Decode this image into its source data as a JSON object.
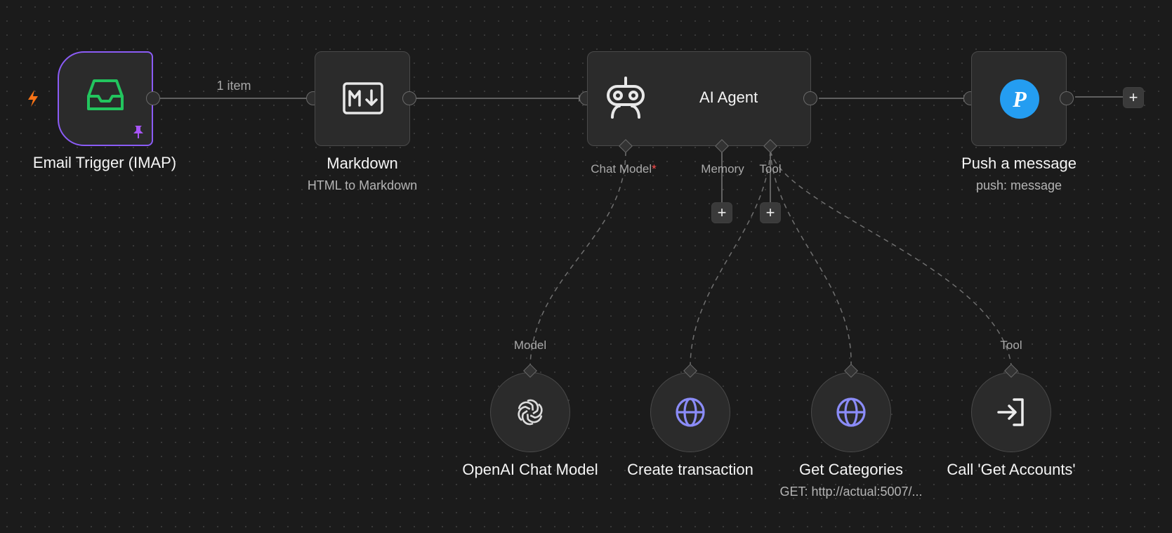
{
  "canvas": {
    "edge_label_1_item": "1 item"
  },
  "nodes": {
    "email_trigger": {
      "title": "Email Trigger (IMAP)",
      "icon": "inbox-icon",
      "icon_color": "#22c55e",
      "border_color": "#8b5cf6",
      "pinned": true
    },
    "markdown": {
      "title": "Markdown",
      "subtitle": "HTML to Markdown",
      "icon": "markdown-icon"
    },
    "ai_agent": {
      "title": "AI Agent",
      "icon": "robot-icon",
      "ports": {
        "chat_model": "Chat Model",
        "chat_model_required": "*",
        "memory": "Memory",
        "tool": "Tool"
      }
    },
    "push_message": {
      "title": "Push a message",
      "subtitle": "push: message",
      "icon": "pushover-icon",
      "icon_color": "#249df1"
    },
    "openai_chat_model": {
      "title": "OpenAI Chat Model",
      "port_label": "Model",
      "icon": "openai-icon"
    },
    "create_transaction": {
      "title": "Create transaction",
      "icon": "globe-icon",
      "icon_color": "#8b8cf8"
    },
    "get_categories": {
      "title": "Get Categories",
      "subtitle": "GET: http://actual:5007/...",
      "icon": "globe-icon",
      "icon_color": "#8b8cf8"
    },
    "call_get_accounts": {
      "title": "Call 'Get Accounts'",
      "port_label": "Tool",
      "icon": "sign-in-arrow-icon"
    }
  },
  "buttons": {
    "plus": "+"
  },
  "colors": {
    "trigger_bolt": "#f97316",
    "pin": "#a855f7"
  }
}
